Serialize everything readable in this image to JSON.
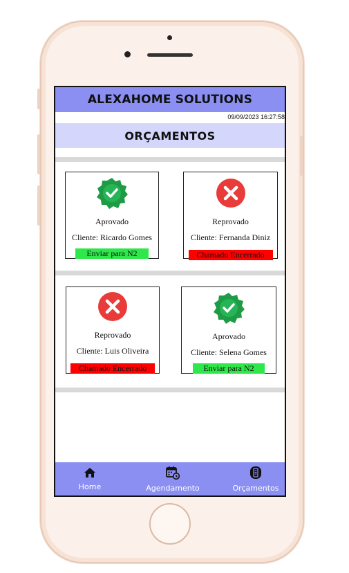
{
  "app": {
    "title": "ALEXAHOME SOLUTIONS",
    "timestamp": "09/09/2023 16:27:58",
    "section_title": "ORÇAMENTOS"
  },
  "cards": [
    {
      "status": "Aprovado",
      "client": "Cliente: Ricardo Gomes",
      "action": "Enviar para N2",
      "state": "approved"
    },
    {
      "status": "Reprovado",
      "client": "Cliente: Fernanda Diniz",
      "action": "Chamado Encerrado",
      "state": "rejected"
    },
    {
      "status": "Reprovado",
      "client": "Cliente: Luis Oliveira",
      "action": "Chamado Encerrado",
      "state": "rejected"
    },
    {
      "status": "Aprovado",
      "client": "Cliente: Selena Gomes",
      "action": "Enviar para N2",
      "state": "approved"
    }
  ],
  "nav": {
    "home": "Home",
    "agendamento": "Agendamento",
    "orcamentos": "Orçamentos"
  },
  "colors": {
    "header": "#8b8ff2",
    "section": "#d4d6fb",
    "approve_badge": "#20a34a",
    "reject_badge": "#ea3b3b",
    "action_green": "#2ee84b",
    "action_red": "#ff0000"
  },
  "icons": {
    "approved": "check-badge-icon",
    "rejected": "x-circle-icon",
    "home": "house-icon",
    "agendamento": "calendar-clock-icon",
    "orcamentos": "document-icon"
  }
}
